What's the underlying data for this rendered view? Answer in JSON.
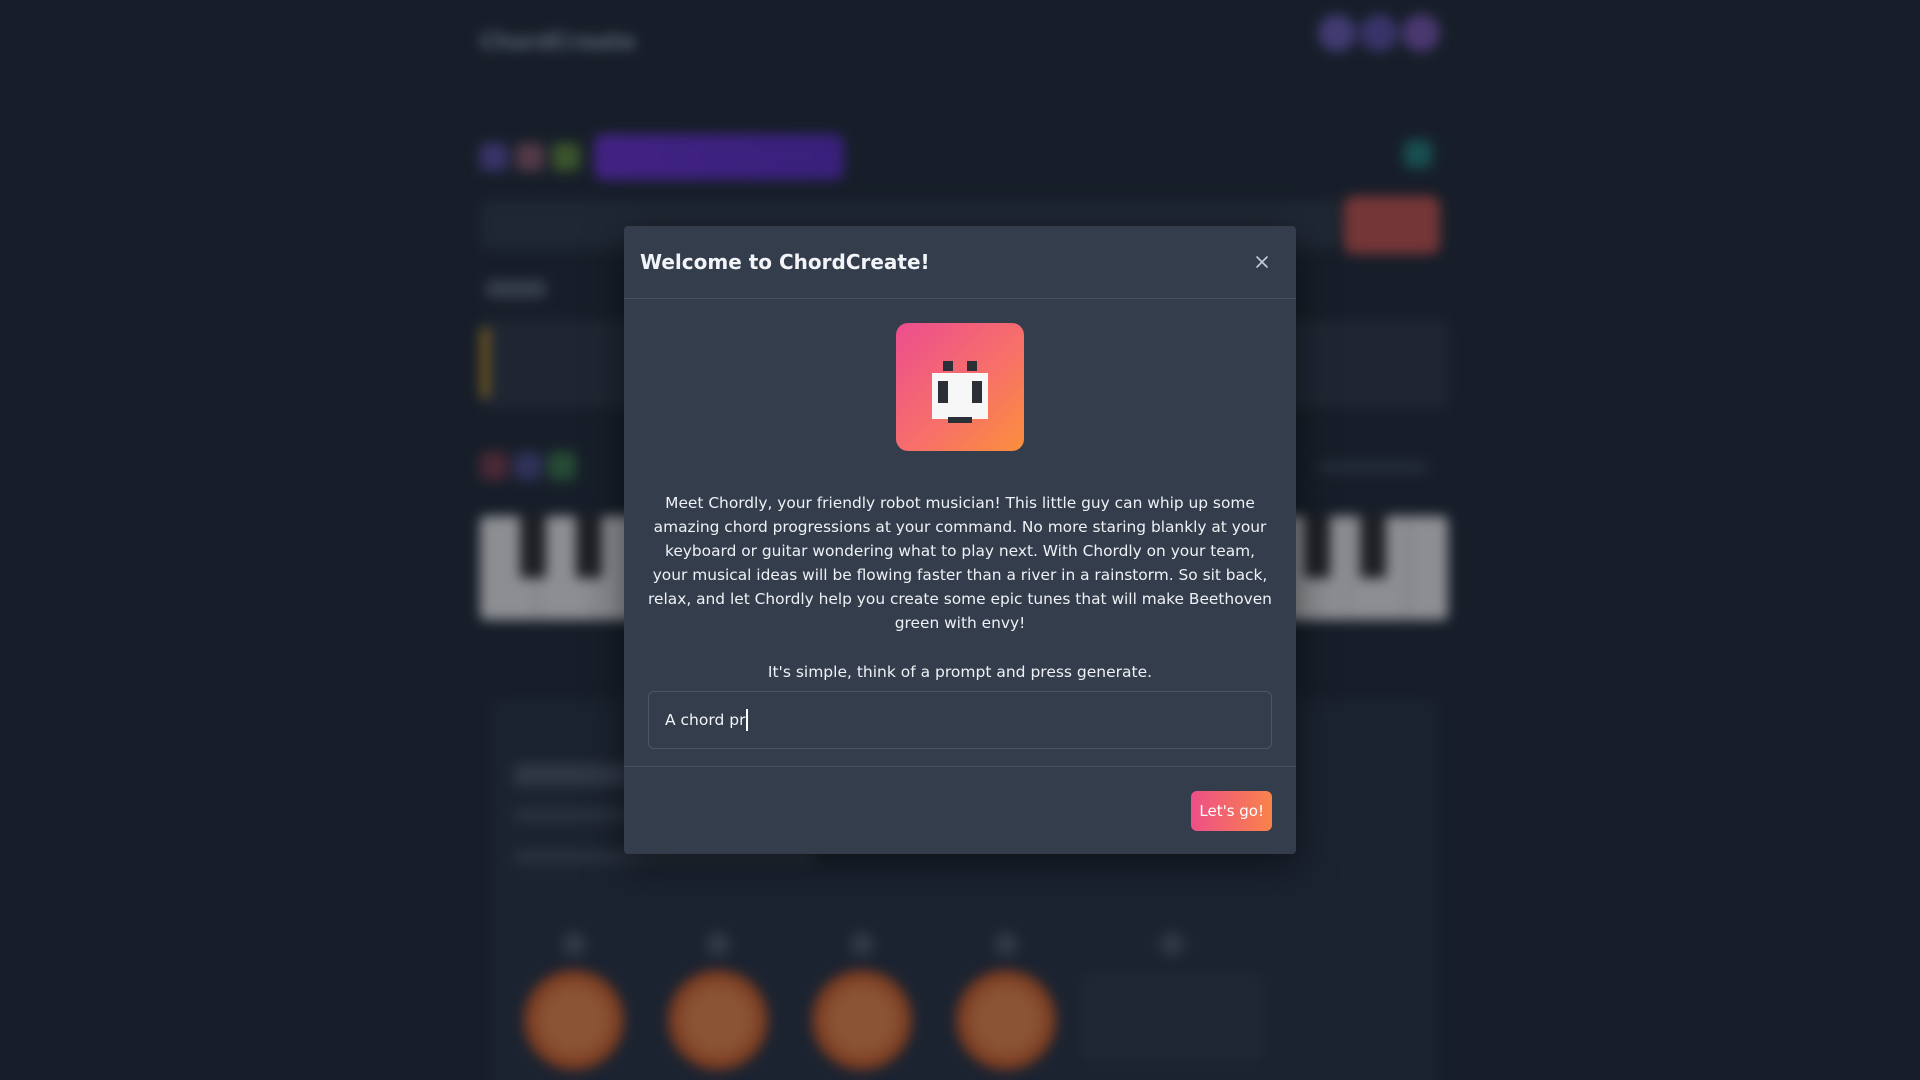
{
  "background": {
    "brand": "ChordCreate"
  },
  "modal": {
    "title": "Welcome to ChordCreate!",
    "robot_icon": "robot-face-icon",
    "intro_text": "Meet Chordly, your friendly robot musician! This little guy can whip up some amazing chord progressions at your command. No more staring blankly at your keyboard or guitar wondering what to play next. With Chordly on your team, your musical ideas will be flowing faster than a river in a rainstorm. So sit back, relax, and let Chordly help you create some epic tunes that will make Beethoven green with envy!",
    "instruction": "It's simple, think of a prompt and press generate.",
    "prompt_value": "A chord pr",
    "submit_label": "Let's go!"
  },
  "colors": {
    "accent_start": "#ee4f86",
    "accent_end": "#f9834b",
    "modal_bg": "#333d4c",
    "page_bg": "#1e2734"
  }
}
